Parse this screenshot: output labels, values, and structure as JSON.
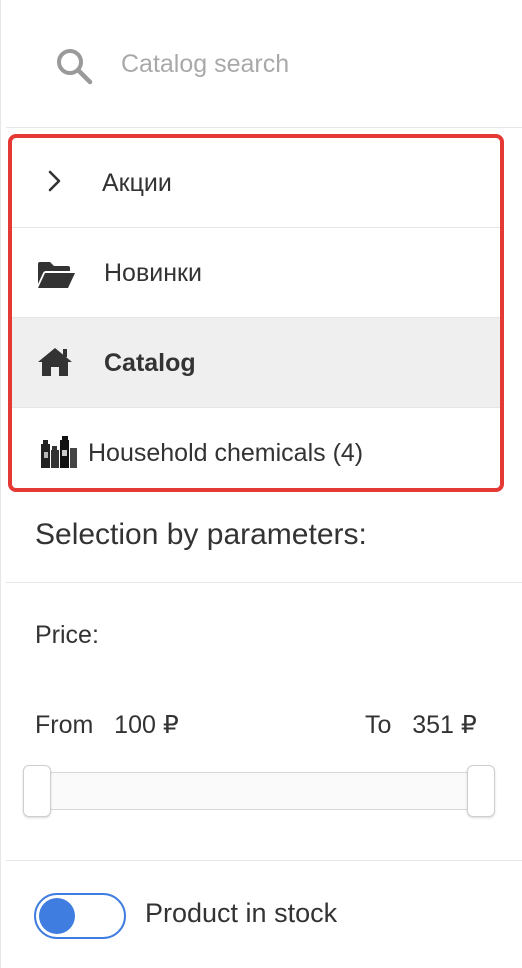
{
  "search": {
    "placeholder": "Catalog search",
    "icon": "search-icon"
  },
  "menu": {
    "items": [
      {
        "label": "Акции",
        "icon": "chevron-right-icon",
        "active": false
      },
      {
        "label": "Новинки",
        "icon": "folder-open-icon",
        "active": false
      },
      {
        "label": "Catalog",
        "icon": "home-icon",
        "active": true
      },
      {
        "label": "Household chemicals (4)",
        "icon": "household-chemicals-thumbnail-icon",
        "active": false
      }
    ],
    "highlight_color": "#e53935"
  },
  "filter": {
    "title": "Selection by parameters:",
    "price": {
      "label": "Price:",
      "from_label": "From",
      "from_value": "100",
      "to_label": "To",
      "to_value": "351",
      "currency": "₽"
    },
    "in_stock": {
      "label": "Product in stock",
      "enabled": false,
      "accent_color": "#3f7de0"
    }
  }
}
